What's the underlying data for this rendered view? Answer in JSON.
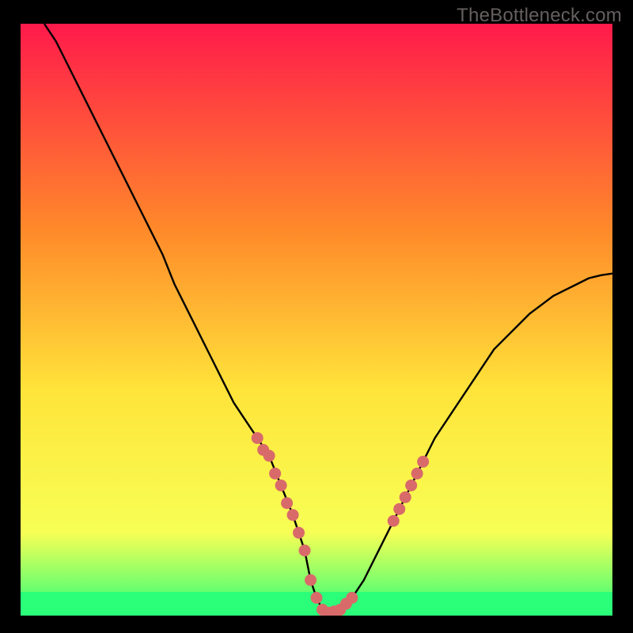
{
  "watermark": "TheBottleneck.com",
  "colors": {
    "gradient_top": "#ff1a4b",
    "gradient_upper_mid": "#ff8a2a",
    "gradient_mid": "#ffe43a",
    "gradient_lower": "#f7ff55",
    "gradient_bottom": "#2bff7a",
    "curve": "#000000",
    "markers": "#d96a6a",
    "frame": "#000000"
  },
  "chart_data": {
    "type": "line",
    "title": "",
    "xlabel": "",
    "ylabel": "",
    "xlim": [
      0,
      100
    ],
    "ylim": [
      0,
      100
    ],
    "series": [
      {
        "name": "bottleneck-curve",
        "x": [
          4,
          6,
          8,
          10,
          12,
          14,
          16,
          18,
          20,
          22,
          24,
          26,
          28,
          30,
          32,
          34,
          36,
          38,
          40,
          42,
          44,
          46,
          48,
          49,
          50,
          51,
          52,
          54,
          56,
          58,
          60,
          62,
          64,
          66,
          68,
          70,
          72,
          74,
          76,
          78,
          80,
          82,
          84,
          86,
          88,
          90,
          92,
          94,
          96,
          98,
          100
        ],
        "y": [
          100,
          97,
          93,
          89,
          85,
          81,
          77,
          73,
          69,
          65,
          61,
          56,
          52,
          48,
          44,
          40,
          36,
          33,
          30,
          27,
          22,
          17,
          11,
          6,
          3,
          1,
          0.5,
          1,
          3,
          6,
          10,
          14,
          18,
          22,
          26,
          30,
          33,
          36,
          39,
          42,
          45,
          47,
          49,
          51,
          52.5,
          54,
          55,
          56,
          57,
          57.5,
          57.8
        ]
      }
    ],
    "markers": {
      "name": "highlight-points",
      "x": [
        40,
        41,
        42,
        43,
        44,
        45,
        46,
        47,
        48,
        49,
        50,
        51,
        52,
        53,
        54,
        55,
        56,
        63,
        64,
        65,
        66,
        67,
        68
      ],
      "y": [
        30,
        28,
        27,
        24,
        22,
        19,
        17,
        14,
        11,
        6,
        3,
        1,
        0.5,
        0.7,
        1,
        2,
        3,
        16,
        18,
        20,
        22,
        24,
        26
      ]
    },
    "green_band_y": [
      0,
      4
    ]
  }
}
